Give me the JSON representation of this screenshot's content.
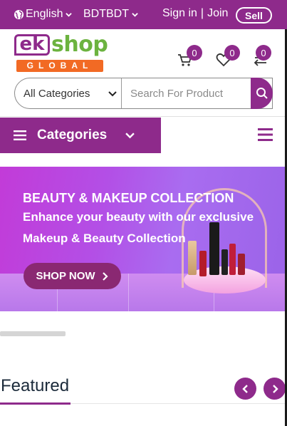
{
  "topbar": {
    "language": "English",
    "currency": "BDT",
    "currency_symbol": "BDT",
    "sign_in": "Sign in",
    "separator": "|",
    "join": "Join",
    "sell": "Sell"
  },
  "logo": {
    "ek": "ek",
    "shop": "shop",
    "global": "GLOBAL"
  },
  "header_icons": {
    "cart_count": "0",
    "wishlist_count": "0",
    "compare_count": "0"
  },
  "search": {
    "category_selected": "All Categories",
    "placeholder": "Search For Product"
  },
  "nav": {
    "categories_label": "Categories"
  },
  "banner": {
    "title": "BEAUTY & MAKEUP COLLECTION",
    "subtitle_line1": "Enhance your beauty with our exclusive",
    "subtitle_line2": "Makeup & Beauty Collection",
    "cta": "SHOP NOW"
  },
  "featured": {
    "heading": "Featured"
  },
  "colors": {
    "brand_purple": "#8e2a8b",
    "brand_green": "#6cb33f",
    "brand_orange": "#f26a24"
  }
}
